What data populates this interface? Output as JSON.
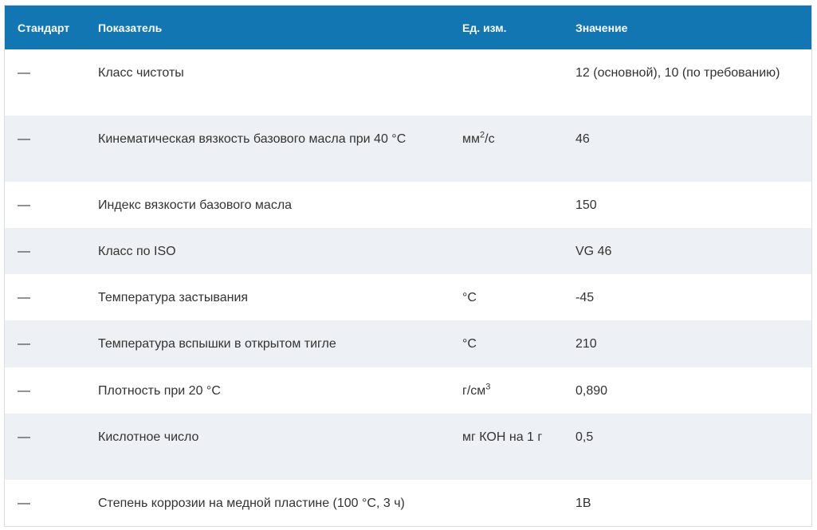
{
  "table": {
    "headers": {
      "standard": "Стандарт",
      "parameter": "Показатель",
      "unit": "Ед. изм.",
      "value": "Значение"
    },
    "rows": [
      {
        "standard": "—",
        "parameter": "Класс чистоты",
        "unit": "",
        "unit_sup": "",
        "value": "12 (основной), 10 (по требованию)"
      },
      {
        "standard": "—",
        "parameter": "Кинематическая вязкость базового масла при 40 °С",
        "unit": "мм",
        "unit_sup": "2",
        "unit_suffix": "/с",
        "value": "46"
      },
      {
        "standard": "—",
        "parameter": "Индекс вязкости базового масла",
        "unit": "",
        "unit_sup": "",
        "value": "150"
      },
      {
        "standard": "—",
        "parameter": "Класс по ISO",
        "unit": "",
        "unit_sup": "",
        "value": "VG 46"
      },
      {
        "standard": "—",
        "parameter": "Температура застывания",
        "unit": "°С",
        "unit_sup": "",
        "value": "-45"
      },
      {
        "standard": "—",
        "parameter": "Температура вспышки в открытом тигле",
        "unit": "°С",
        "unit_sup": "",
        "value": "210"
      },
      {
        "standard": "—",
        "parameter": "Плотность при 20 °С",
        "unit": "г/см",
        "unit_sup": "3",
        "value": "0,890"
      },
      {
        "standard": "—",
        "parameter": "Кислотное число",
        "unit": "мг КОН на 1 г",
        "unit_sup": "",
        "value": "0,5"
      },
      {
        "standard": "—",
        "parameter": "Степень коррозии на медной пластине (100 °С, 3 ч)",
        "unit": "",
        "unit_sup": "",
        "value": "1В"
      }
    ]
  }
}
